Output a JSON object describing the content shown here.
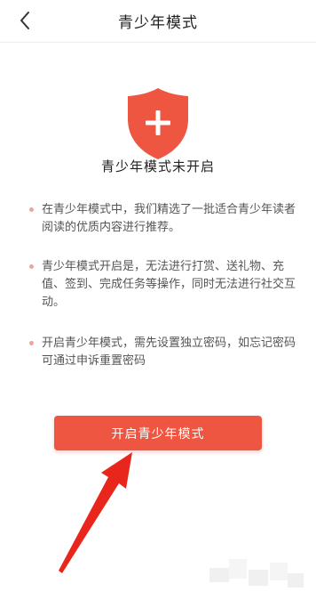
{
  "header": {
    "title": "青少年模式",
    "back_icon": "chevron-left-icon"
  },
  "status": {
    "icon": "shield-plus-icon",
    "text": "青少年模式未开启"
  },
  "notices": [
    "在青少年模式中，我们精选了一批适合青少年读者阅读的优质内容进行推荐。",
    "青少年模式开启是，无法进行打赏、送礼物、充值、签到、完成任务等操作，同时无法进行社交互动。",
    "开启青少年模式，需先设置独立密码，如忘记密码可通过申诉重置密码"
  ],
  "action": {
    "enable_label": "开启青少年模式"
  },
  "colors": {
    "accent": "#ee5641",
    "shield": "#ee5641",
    "bullet": "#f2a49a",
    "annotation_arrow": "#e8261c"
  }
}
